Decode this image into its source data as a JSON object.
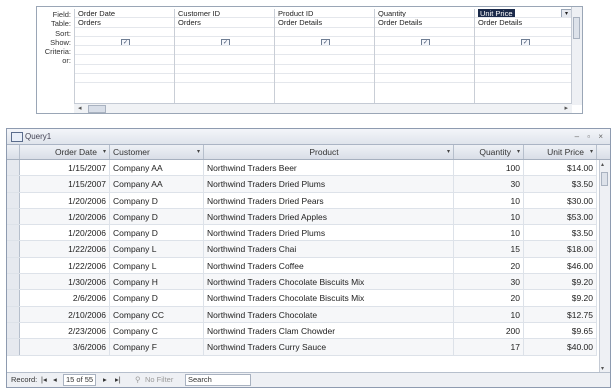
{
  "design": {
    "labels": [
      "Field:",
      "Table:",
      "Sort:",
      "Show:",
      "Criteria:",
      "or:"
    ],
    "columns": [
      {
        "field": "Order Date",
        "table": "Orders",
        "show": true
      },
      {
        "field": "Customer ID",
        "table": "Orders",
        "show": true
      },
      {
        "field": "Product ID",
        "table": "Order Details",
        "show": true
      },
      {
        "field": "Quantity",
        "table": "Order Details",
        "show": true
      },
      {
        "field": "Unit Price",
        "table": "Order Details",
        "show": true
      }
    ],
    "check_glyph": "☑"
  },
  "window": {
    "title": "Query1",
    "controls": "– ▫ ×"
  },
  "headers": [
    "Order Date",
    "Customer",
    "Product",
    "Quantity",
    "Unit Price"
  ],
  "rows": [
    [
      "1/15/2007",
      "Company AA",
      "Northwind Traders Beer",
      "100",
      "$14.00"
    ],
    [
      "1/15/2007",
      "Company AA",
      "Northwind Traders Dried Plums",
      "30",
      "$3.50"
    ],
    [
      "1/20/2006",
      "Company D",
      "Northwind Traders Dried Pears",
      "10",
      "$30.00"
    ],
    [
      "1/20/2006",
      "Company D",
      "Northwind Traders Dried Apples",
      "10",
      "$53.00"
    ],
    [
      "1/20/2006",
      "Company D",
      "Northwind Traders Dried Plums",
      "10",
      "$3.50"
    ],
    [
      "1/22/2006",
      "Company L",
      "Northwind Traders Chai",
      "15",
      "$18.00"
    ],
    [
      "1/22/2006",
      "Company L",
      "Northwind Traders Coffee",
      "20",
      "$46.00"
    ],
    [
      "1/30/2006",
      "Company H",
      "Northwind Traders Chocolate Biscuits Mix",
      "30",
      "$9.20"
    ],
    [
      "2/6/2006",
      "Company D",
      "Northwind Traders Chocolate Biscuits Mix",
      "20",
      "$9.20"
    ],
    [
      "2/10/2006",
      "Company CC",
      "Northwind Traders Chocolate",
      "10",
      "$12.75"
    ],
    [
      "2/23/2006",
      "Company C",
      "Northwind Traders Clam Chowder",
      "200",
      "$9.65"
    ],
    [
      "3/6/2006",
      "Company F",
      "Northwind Traders Curry Sauce",
      "17",
      "$40.00"
    ]
  ],
  "nav": {
    "record_label": "Record:",
    "first": "|◂",
    "prev": "◂",
    "position": "15 of 55",
    "next": "▸",
    "last": "▸|",
    "filter": "No Filter",
    "search": "Search"
  }
}
